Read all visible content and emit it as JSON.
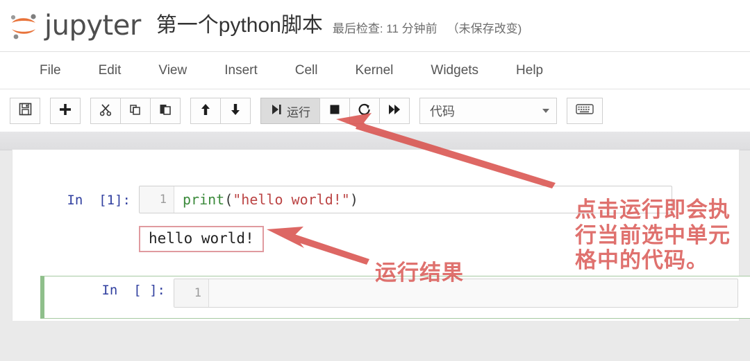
{
  "header": {
    "logo_icon": "jupyter-logo",
    "brand": "jupyter",
    "notebook_title": "第一个python脚本",
    "checkpoint_label": "最后检查: 11 分钟前",
    "unsaved_label": "（未保存改变)"
  },
  "menubar": {
    "items": [
      {
        "label": "File"
      },
      {
        "label": "Edit"
      },
      {
        "label": "View"
      },
      {
        "label": "Insert"
      },
      {
        "label": "Cell"
      },
      {
        "label": "Kernel"
      },
      {
        "label": "Widgets"
      },
      {
        "label": "Help"
      }
    ]
  },
  "toolbar": {
    "save_icon": "floppy-disk-icon",
    "add_icon": "plus-icon",
    "cut_icon": "scissors-icon",
    "copy_icon": "copy-icon",
    "paste_icon": "paste-icon",
    "move_up_icon": "arrow-up-icon",
    "move_down_icon": "arrow-down-icon",
    "run_icon": "run-step-icon",
    "run_label": "运行",
    "stop_icon": "stop-square-icon",
    "restart_icon": "restart-circle-icon",
    "fastforward_icon": "fast-forward-icon",
    "celltype_value": "代码",
    "celltype_caret": "chevron-down-icon",
    "commandpalette_icon": "keyboard-icon"
  },
  "notebook": {
    "cells": [
      {
        "prompt": "In  [1]:",
        "line_number": "1",
        "code_fn": "print",
        "code_open": "(",
        "code_str": "\"hello world!\"",
        "code_close": ")",
        "output_text": "hello world!"
      },
      {
        "prompt": "In  [ ]:",
        "line_number": "1",
        "code_text": ""
      }
    ]
  },
  "annotations": {
    "run_note": "点击运行即会执行当前选中单元格中的代码。",
    "result_note": "运行结果",
    "arrow_color": "#d9534f"
  },
  "colors": {
    "jupyter_orange": "#e8733a",
    "annotation_red": "#d9534f",
    "selected_cell_green": "#8fbf8b",
    "output_box_border": "#e09a9f",
    "code_function_green": "#3b8a3b",
    "code_string_red": "#bb4444",
    "prompt_blue": "#303f9f"
  }
}
